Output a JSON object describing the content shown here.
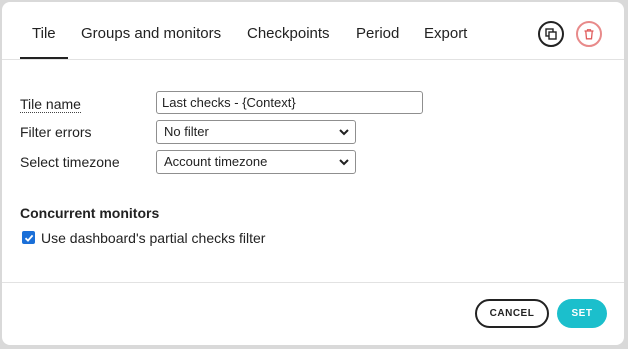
{
  "tabs": [
    {
      "label": "Tile",
      "active": true
    },
    {
      "label": "Groups and monitors",
      "active": false
    },
    {
      "label": "Checkpoints",
      "active": false
    },
    {
      "label": "Period",
      "active": false
    },
    {
      "label": "Export",
      "active": false
    }
  ],
  "header_actions": {
    "copy_icon": "copy-icon",
    "delete_icon": "trash-icon",
    "delete_color": "#e88a8a"
  },
  "form": {
    "tile_name": {
      "label": "Tile name",
      "value": "Last checks - {Context}"
    },
    "filter_errors": {
      "label": "Filter errors",
      "value": "No filter"
    },
    "timezone": {
      "label": "Select timezone",
      "value": "Account timezone"
    }
  },
  "concurrent_monitors": {
    "heading": "Concurrent monitors",
    "checkbox_label": "Use dashboard's partial checks filter",
    "checked": true
  },
  "footer": {
    "cancel_label": "CANCEL",
    "set_label": "SET",
    "accent_color": "#1bbfcc"
  }
}
